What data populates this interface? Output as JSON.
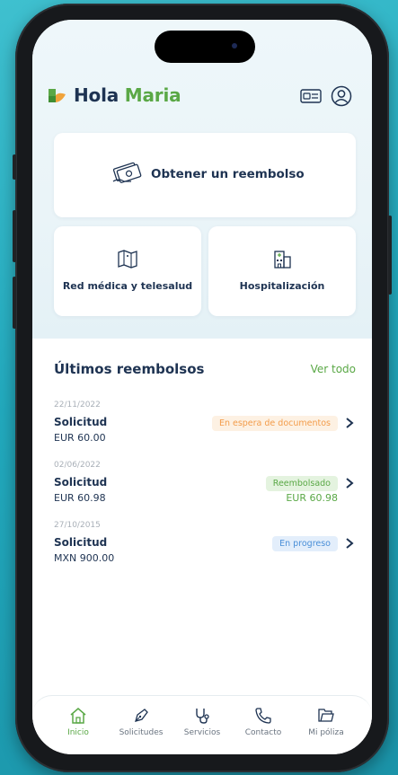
{
  "header": {
    "greeting": "Hola",
    "user_name": "Maria"
  },
  "cards": {
    "reimbursement": "Obtener un reembolso",
    "network": "Red médica y telesalud",
    "hospitalization": "Hospitalización"
  },
  "recent": {
    "title": "Últimos reembolsos",
    "see_all": "Ver todo",
    "items": [
      {
        "date": "22/11/2022",
        "label": "Solicitud",
        "amount": "EUR 60.00",
        "status": "En espera de documentos",
        "status_color": "#f39c4a",
        "status_bg": "#fdf1e3",
        "reimbursed_amount": ""
      },
      {
        "date": "02/06/2022",
        "label": "Solicitud",
        "amount": "EUR 60.98",
        "status": "Reembolsado",
        "status_color": "#5aa846",
        "status_bg": "#e4f3df",
        "reimbursed_amount": "EUR 60.98"
      },
      {
        "date": "27/10/2015",
        "label": "Solicitud",
        "amount": "MXN 900.00",
        "status": "En progreso",
        "status_color": "#4a8fd8",
        "status_bg": "#e3eefb",
        "reimbursed_amount": ""
      }
    ]
  },
  "nav": {
    "items": [
      {
        "label": "Inicio",
        "icon": "home-icon",
        "active": true
      },
      {
        "label": "Solicitudes",
        "icon": "pen-icon",
        "active": false
      },
      {
        "label": "Servicios",
        "icon": "stethoscope-icon",
        "active": false
      },
      {
        "label": "Contacto",
        "icon": "phone-icon",
        "active": false
      },
      {
        "label": "Mi póliza",
        "icon": "folder-icon",
        "active": false
      }
    ]
  },
  "colors": {
    "brand_green": "#5aa846",
    "navy": "#1e3352",
    "background": "#22a9bd"
  }
}
